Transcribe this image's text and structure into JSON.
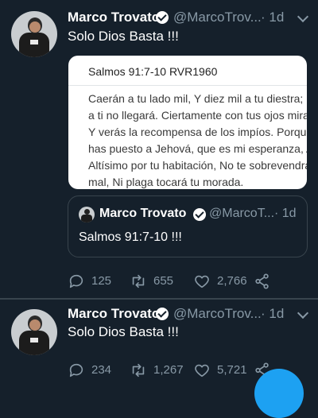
{
  "tweets": [
    {
      "author": "Marco Trovato",
      "handle": "@MarcoTrov...",
      "time": "· 1d",
      "text": "Solo Dios Basta !!!",
      "card": {
        "title": "Salmos 91:7-10 RVR1960",
        "lines": [
          "Caerán a tu lado mil, Y diez mil a tu diestra; M",
          "a ti no llegará. Ciertamente con tus ojos mira",
          "Y verás la recompensa de los impíos. Porque",
          "has puesto a Jehová, que es mi esperanza, A",
          "Altísimo por tu habitación, No te sobrevendra",
          "mal, Ni plaga tocará tu morada."
        ]
      },
      "quote": {
        "author": "Marco Trovato",
        "handle": "@MarcoT...",
        "time": "· 1d",
        "text": "Salmos 91:7-10 !!!"
      },
      "stats": {
        "replies": "125",
        "retweets": "655",
        "likes": "2,766"
      }
    },
    {
      "author": "Marco Trovato",
      "handle": "@MarcoTrov...",
      "time": "· 1d",
      "text": "Solo Dios Basta !!!",
      "stats": {
        "replies": "234",
        "retweets": "1,267",
        "likes": "5,721"
      }
    }
  ],
  "icons": {
    "reply": "reply-icon",
    "retweet": "retweet-icon",
    "like": "heart-icon",
    "share": "share-icon",
    "verified": "verified-badge-icon",
    "more": "chevron-down-icon"
  },
  "colors": {
    "background": "#15202b",
    "secondary_text": "#8899a6",
    "divider": "#38444d",
    "accent": "#1da1f2"
  }
}
